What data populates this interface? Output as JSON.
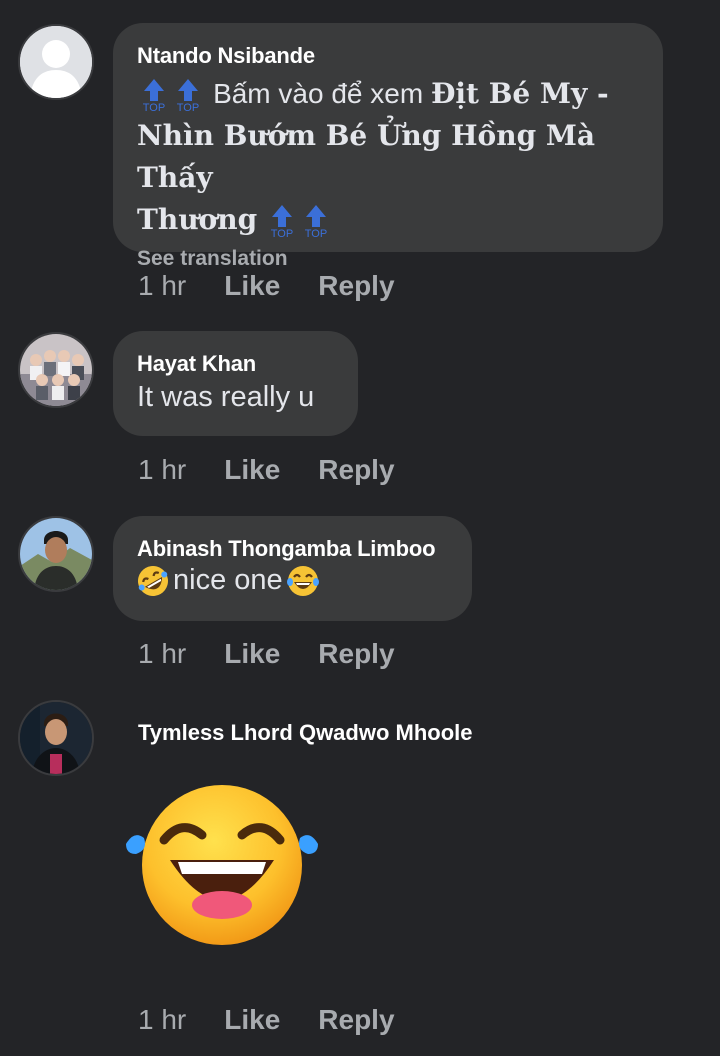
{
  "comments": [
    {
      "author": "Ntando Nsibande",
      "text_prefix": "Bấm vào để xem ",
      "text_bold_1": "Địt Bé My -",
      "text_bold_2": "Nhìn Bướm Bé Ửng Hồng Mà Thấy",
      "text_bold_3": "Thương",
      "top_label": "TOP",
      "see_translation": "See translation",
      "time": "1 hr",
      "like": "Like",
      "reply": "Reply",
      "avatar": "default-avatar-icon"
    },
    {
      "author": "Hayat Khan",
      "text": "It was really u",
      "time": "1 hr",
      "like": "Like",
      "reply": "Reply",
      "avatar": "group-photo-avatar"
    },
    {
      "author": "Abinash Thongamba Limboo",
      "text": "nice one",
      "time": "1 hr",
      "like": "Like",
      "reply": "Reply",
      "avatar": "person-photo-avatar"
    },
    {
      "author": "Tymless Lhord Qwadwo Mhoole",
      "sticker": "laughing-emoji-sticker",
      "time": "1 hr",
      "like": "Like",
      "reply": "Reply",
      "avatar": "person-photo-avatar"
    }
  ],
  "colors": {
    "background": "#232427",
    "bubble": "#3a3b3c",
    "secondary_text": "#a8abaf",
    "top_arrow": "#3b6fd8"
  }
}
